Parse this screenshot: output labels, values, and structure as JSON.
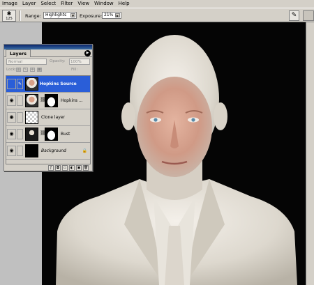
{
  "menu": [
    "Image",
    "Layer",
    "Select",
    "Filter",
    "View",
    "Window",
    "Help"
  ],
  "options": {
    "brush_size": "125",
    "range_label": "Range:",
    "range_value": "Highlights",
    "exposure_label": "Exposure:",
    "exposure_value": "21%"
  },
  "layers_panel": {
    "tab_title": "Layers",
    "blend_mode": "Normal",
    "opacity_label": "Opacity:",
    "opacity_value": "100%",
    "lock_label": "Lock:",
    "fill_label": "Fill:",
    "fill_value": "100%",
    "layers": [
      {
        "name": "Hopkins Source",
        "selected": true,
        "visible": false,
        "thumb": "portrait"
      },
      {
        "name": "Hopkins ...",
        "selected": false,
        "visible": true,
        "thumb": "portrait",
        "has_mask": true
      },
      {
        "name": "Clone layer",
        "selected": false,
        "visible": true,
        "thumb": "checker"
      },
      {
        "name": "Bust",
        "selected": false,
        "visible": true,
        "thumb": "bust",
        "has_mask": true
      },
      {
        "name": "Background",
        "selected": false,
        "visible": true,
        "thumb": "black",
        "locked": true
      }
    ]
  }
}
